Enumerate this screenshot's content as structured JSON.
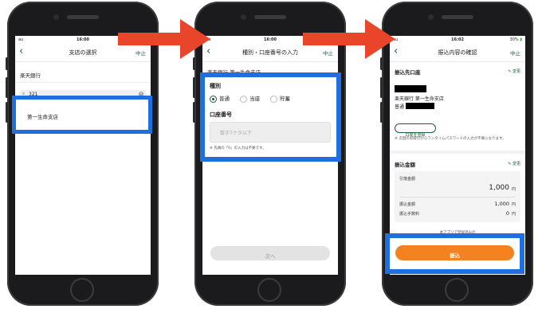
{
  "phone1": {
    "status_carrier": "au",
    "status_time": "16:00",
    "nav_title": "支店の選択",
    "nav_cancel": "中止",
    "bank_name": "楽天銀行",
    "search_value": "321",
    "result_item": "第一生命支店"
  },
  "phone2": {
    "status_carrier": "au",
    "status_time": "16:00",
    "nav_title": "種別・口座番号の入力",
    "nav_cancel": "中止",
    "branch_line": "楽天銀行 第一生命支店",
    "type_label": "種別",
    "type_options": [
      "普通",
      "当座",
      "貯蓄"
    ],
    "account_label": "口座番号",
    "account_placeholder": "数字7ケタ以下",
    "note": "※ 先頭の「0」の入力は不要です。",
    "next_button": "次へ"
  },
  "phone3": {
    "status_carrier": "au",
    "status_time": "16:02",
    "status_battery": "30%",
    "nav_title": "振込内容の確認",
    "nav_cancel": "中止",
    "dest_label": "振込先口座",
    "dest_edit": "変更",
    "dest_bank": "楽天銀行 第一生命支店",
    "dest_type": "普通",
    "register_button": "口座を登録",
    "register_note": "※ 次回のお取引からワンタイムパスワードの入力が不要になります。",
    "amount_label": "振込金額",
    "amount_edit": "変更",
    "withdraw_label": "引落金額",
    "withdraw_value": "1,000",
    "withdraw_unit": "円",
    "transfer_label": "振込金額",
    "transfer_value": "1,000",
    "transfer_unit": "円",
    "fee_label": "振込手数料",
    "fee_value": "0",
    "fee_unit": "円",
    "app_text": "本アプリで登録済みの",
    "submit_button": "振込"
  },
  "colors": {
    "highlight": "#1f6fe0",
    "arrow": "#e8452a",
    "brand_green": "#1d5b3c",
    "submit_orange": "#f5821f"
  }
}
